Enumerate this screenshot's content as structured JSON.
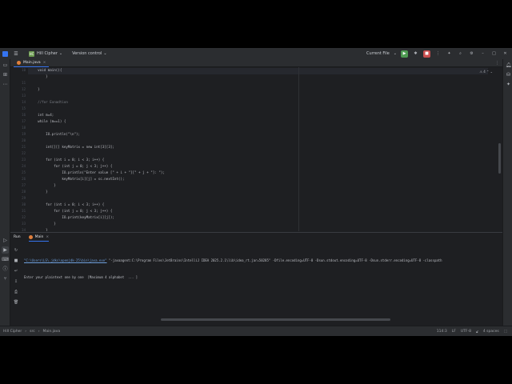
{
  "titlebar": {
    "project_badge": "HC",
    "project_name": "Hill Cipher",
    "version_control": "Version control",
    "run_config": "Current File"
  },
  "tabs": [
    {
      "label": "Main.java"
    }
  ],
  "editor": {
    "inspections": "4",
    "line_numbers": [
      "10",
      "",
      "11",
      "12",
      "13",
      "14",
      "15",
      "16",
      "17",
      "18",
      "19",
      "20",
      "21",
      "22",
      "23",
      "24",
      "25",
      "26",
      "27",
      "28",
      "29",
      "30",
      "31",
      "32",
      "33",
      "34"
    ],
    "lines": [
      "    void main(){",
      "        }",
      "",
      "    }",
      "",
      "    //for Exnadtion",
      "",
      "    int m=4;",
      "    while (m==1) {",
      "",
      "        IO.println(\"\\n\");",
      "",
      "        int[][] keyMatrix = new int[3][3];",
      "",
      "        for (int i = 0; i < 3; i++) {",
      "            for (int j = 0; j < 3; j++) {",
      "                IO.println(\"Enter value [\" + i + \"][\" + j + \"]: \");",
      "                keyMatrix[i][j] = sc.nextInt();",
      "            }",
      "        }",
      "",
      "        for (int i = 0; i < 3; i++) {",
      "            for (int j = 0; j < 3; j++) {",
      "                IO.print(keyMatrix[i][j]);",
      "            }",
      "        }"
    ]
  },
  "run": {
    "title": "Run",
    "tab_label": "Main",
    "console_path": "\"C:\\Users\\LS\\.jdks\\openjdk-25\\bin\\java.exe\"",
    "console_args": " \"-javaagent:C:\\Program Files\\JetBrains\\IntelliJ IDEA 2025.2.1\\lib\\idea_rt.jar=50285\" -Dfile.encoding=UTF-8 -Dsun.stdout.encoding=UTF-8 -Dsun.stderr.encoding=UTF-8 -classpath",
    "console_prompt": "Enter your plaintext one by one  [Maximum 4 alphabet  ... ]"
  },
  "statusbar": {
    "crumbs": [
      "Hill Cipher",
      "src",
      "Main.java"
    ],
    "position": "114:3",
    "line_sep": "LF",
    "encoding": "UTF-8",
    "indent": "4 spaces"
  }
}
